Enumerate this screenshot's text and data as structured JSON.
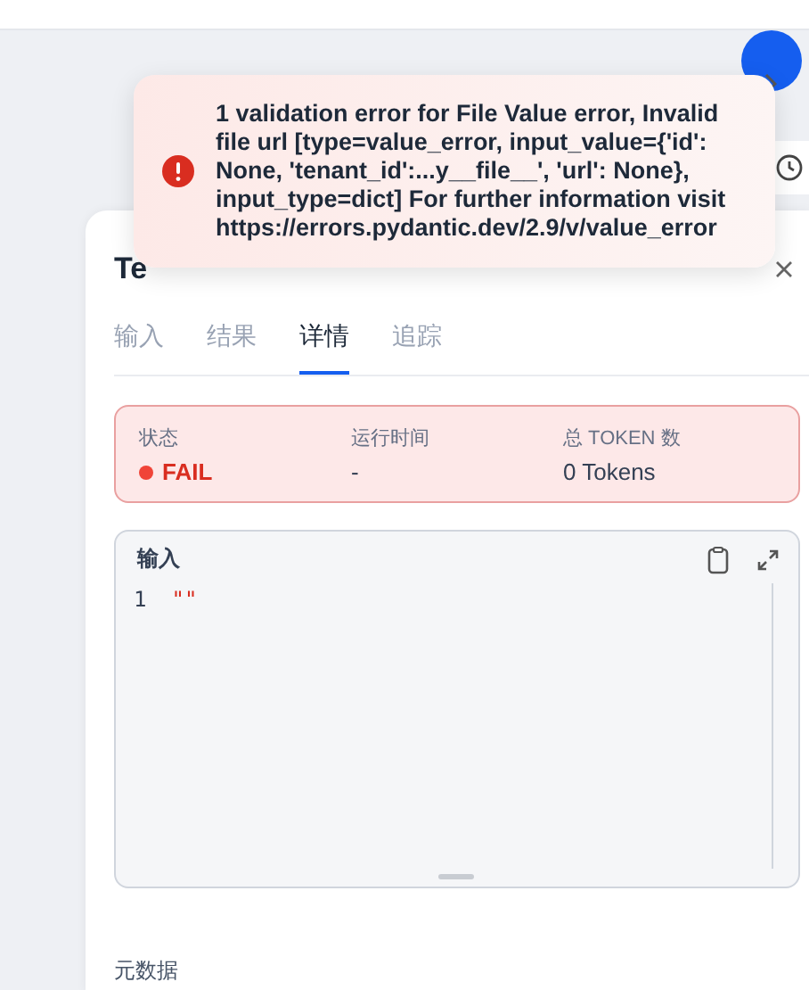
{
  "toast": {
    "kind": "error",
    "message": "1 validation error for File Value error, Invalid file url [type=value_error, input_value={'id': None, 'tenant_id':...y__file__', 'url': None}, input_type=dict] For further information visit https://errors.pydantic.dev/2.9/v/value_error"
  },
  "panel": {
    "title": "Te",
    "tabs": [
      {
        "label": "输入",
        "selected": false
      },
      {
        "label": "结果",
        "selected": false
      },
      {
        "label": "详情",
        "selected": true
      },
      {
        "label": "追踪",
        "selected": false
      }
    ],
    "status": {
      "failed": true,
      "fields": [
        {
          "label": "状态",
          "value": "FAIL",
          "kind": "status"
        },
        {
          "label": "运行时间",
          "value": "-",
          "kind": "text"
        },
        {
          "label": "总 TOKEN 数",
          "value": "0 Tokens",
          "kind": "text"
        }
      ]
    },
    "editor": {
      "title": "输入",
      "lines": [
        {
          "number": "1",
          "code": "\"\""
        }
      ]
    },
    "metadata_label": "元数据"
  }
}
